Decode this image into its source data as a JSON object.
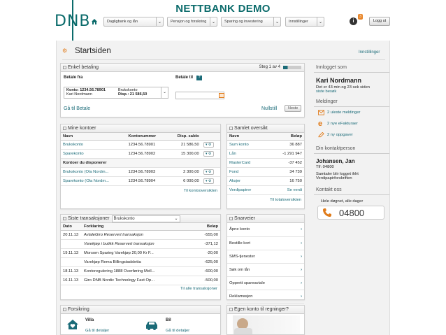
{
  "banner": {
    "title": "NETTBANK DEMO"
  },
  "header": {
    "logo_text": "DNB",
    "nav": [
      "Dagligbank og lån",
      "Pensjon og forsikring",
      "Sparing og investering",
      "Innstillinger"
    ],
    "badge": "3",
    "logout": "Logg ut"
  },
  "page": {
    "title": "Startsiden",
    "settings_link": "Innstillinger"
  },
  "payment": {
    "title": "Enkel betaling",
    "step": "Steg 1 av 4",
    "from_label": "Betale fra",
    "to_label": "Betale til",
    "account_line1": "Konto: 1234.56.78901",
    "account_line2": "Kari Nordmann",
    "account_type": "Brukskonto",
    "disp": "Disp.: 21 586,50",
    "goto": "Gå til Betale",
    "reset": "Nullstill",
    "next": "Neste"
  },
  "accounts": {
    "title": "Mine kontoer",
    "headers": [
      "Navn",
      "Kontonummer",
      "Disp. saldo"
    ],
    "rows": [
      {
        "name": "Brukskonto",
        "number": "1234.56.78901",
        "balance": "21 586,50"
      },
      {
        "name": "Sparekonto",
        "number": "1234.56.78902",
        "balance": "15 300,00"
      }
    ],
    "group": "Kontoer du disponerer",
    "rows2": [
      {
        "name": "Brukskonto (Ola Nordm...",
        "number": "1234.56.78903",
        "balance": "2 300,00"
      },
      {
        "name": "Sparekonto (Ola Nordm...",
        "number": "1234.56.78904",
        "balance": "6 000,00"
      }
    ],
    "link": "Til kontooversikten"
  },
  "overview": {
    "title": "Samlet oversikt",
    "headers": [
      "Navn",
      "Beløp"
    ],
    "rows": [
      {
        "name": "Sum konto",
        "amount": "36 887"
      },
      {
        "name": "Lån",
        "amount": "-1 291 947"
      },
      {
        "name": "MasterCard",
        "amount": "-37 452"
      },
      {
        "name": "Fond",
        "amount": "34 739"
      },
      {
        "name": "Aksjer",
        "amount": "16 750"
      },
      {
        "name": "Verdipapirer",
        "amount": "Se verdi"
      }
    ],
    "link": "Til totaloversikten"
  },
  "transactions": {
    "title": "Siste transaksjoner",
    "account": "Brukskonto",
    "headers": [
      "Dato",
      "Forklaring",
      "Beløp"
    ],
    "rows": [
      {
        "date": "20.11.13",
        "desc": "AvtaleGiro Reservert transaksjon",
        "amount": "-555,00"
      },
      {
        "date": "",
        "desc": "Varekjøp i butikk Reservert transaksjon",
        "amount": "-371,12"
      },
      {
        "date": "19.11.13",
        "desc": "Morsom Sparing Varekjøp 20,00 Kr F...",
        "amount": "-20,00"
      },
      {
        "date": "",
        "desc": "Varekjøp Rema Billingstadsletta",
        "amount": "-625,00"
      },
      {
        "date": "18.11.13",
        "desc": "Kontoregulering 1888 Overføring Mell...",
        "amount": "-600,00"
      },
      {
        "date": "16.11.13",
        "desc": "Giro DNB Nordic Technology Fast Op...",
        "amount": "-500,00"
      }
    ],
    "link": "Til alle transaksjoner"
  },
  "shortcuts": {
    "title": "Snarveier",
    "items": [
      "Åpne konto",
      "Bestille kort",
      "SMS-tjenester",
      "Søk om lån",
      "Opprett spareavtale",
      "Reklamasjon"
    ]
  },
  "insurance": {
    "title": "Forsikring",
    "items": [
      {
        "label": "Villa",
        "link": "Gå til detaljer"
      },
      {
        "label": "Bil",
        "link": "Gå til detaljer"
      }
    ]
  },
  "promo": {
    "title": "Egen konto til regninger?"
  },
  "sidebar": {
    "logged_in_heading": "Innlogget som",
    "user": "Kari Nordmann",
    "session": "Det er 43 min og 23 sek siden",
    "last_visit": "siste besøk",
    "messages_heading": "Meldinger",
    "messages": [
      "2 uleste meldinger",
      "2 nye eFakturaer",
      "2 ny oppgaver"
    ],
    "contact_heading": "Din kontaktperson",
    "contact_name": "Johansen, Jan",
    "contact_phone": "Tlf: 04800",
    "contact_note1": "Samtaler blir logget ihht",
    "contact_note2": "Verdipapirforskriften",
    "contact_us_heading": "Kontakt oss",
    "contact_us_hours": "Hele døgnet, alle dager",
    "contact_us_phone": "04800"
  },
  "colors": {
    "brand": "#0b6b6b",
    "link": "#1a6b78",
    "accent": "#e07b1a"
  }
}
